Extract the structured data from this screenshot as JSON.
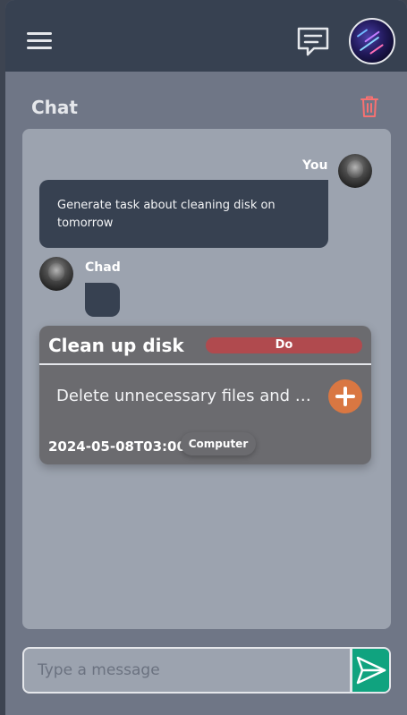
{
  "topbar": {
    "menu_icon": "hamburger-menu-icon",
    "chat_icon": "chat-bubble-icon",
    "avatar_icon": "user-avatar"
  },
  "chat": {
    "title": "Chat",
    "delete_icon": "trash-icon",
    "delete_color": "#f87171"
  },
  "messages": [
    {
      "sender": "You",
      "text": "Generate task about cleaning disk on tomorrow"
    },
    {
      "sender": "Chad",
      "text": ""
    }
  ],
  "task": {
    "title": "Clean up disk",
    "status": "Do",
    "description": "Delete unnecessary files and programs",
    "date": "2024-05-08T03:00",
    "tag": "Computer",
    "add_icon": "plus-icon"
  },
  "composer": {
    "placeholder": "Type a message",
    "send_icon": "send-icon"
  },
  "colors": {
    "topbar": "#374151",
    "panel": "#9ca3af",
    "status_do": "#b04a4e",
    "add_button": "#d97742",
    "send_button": "#10a37f"
  }
}
